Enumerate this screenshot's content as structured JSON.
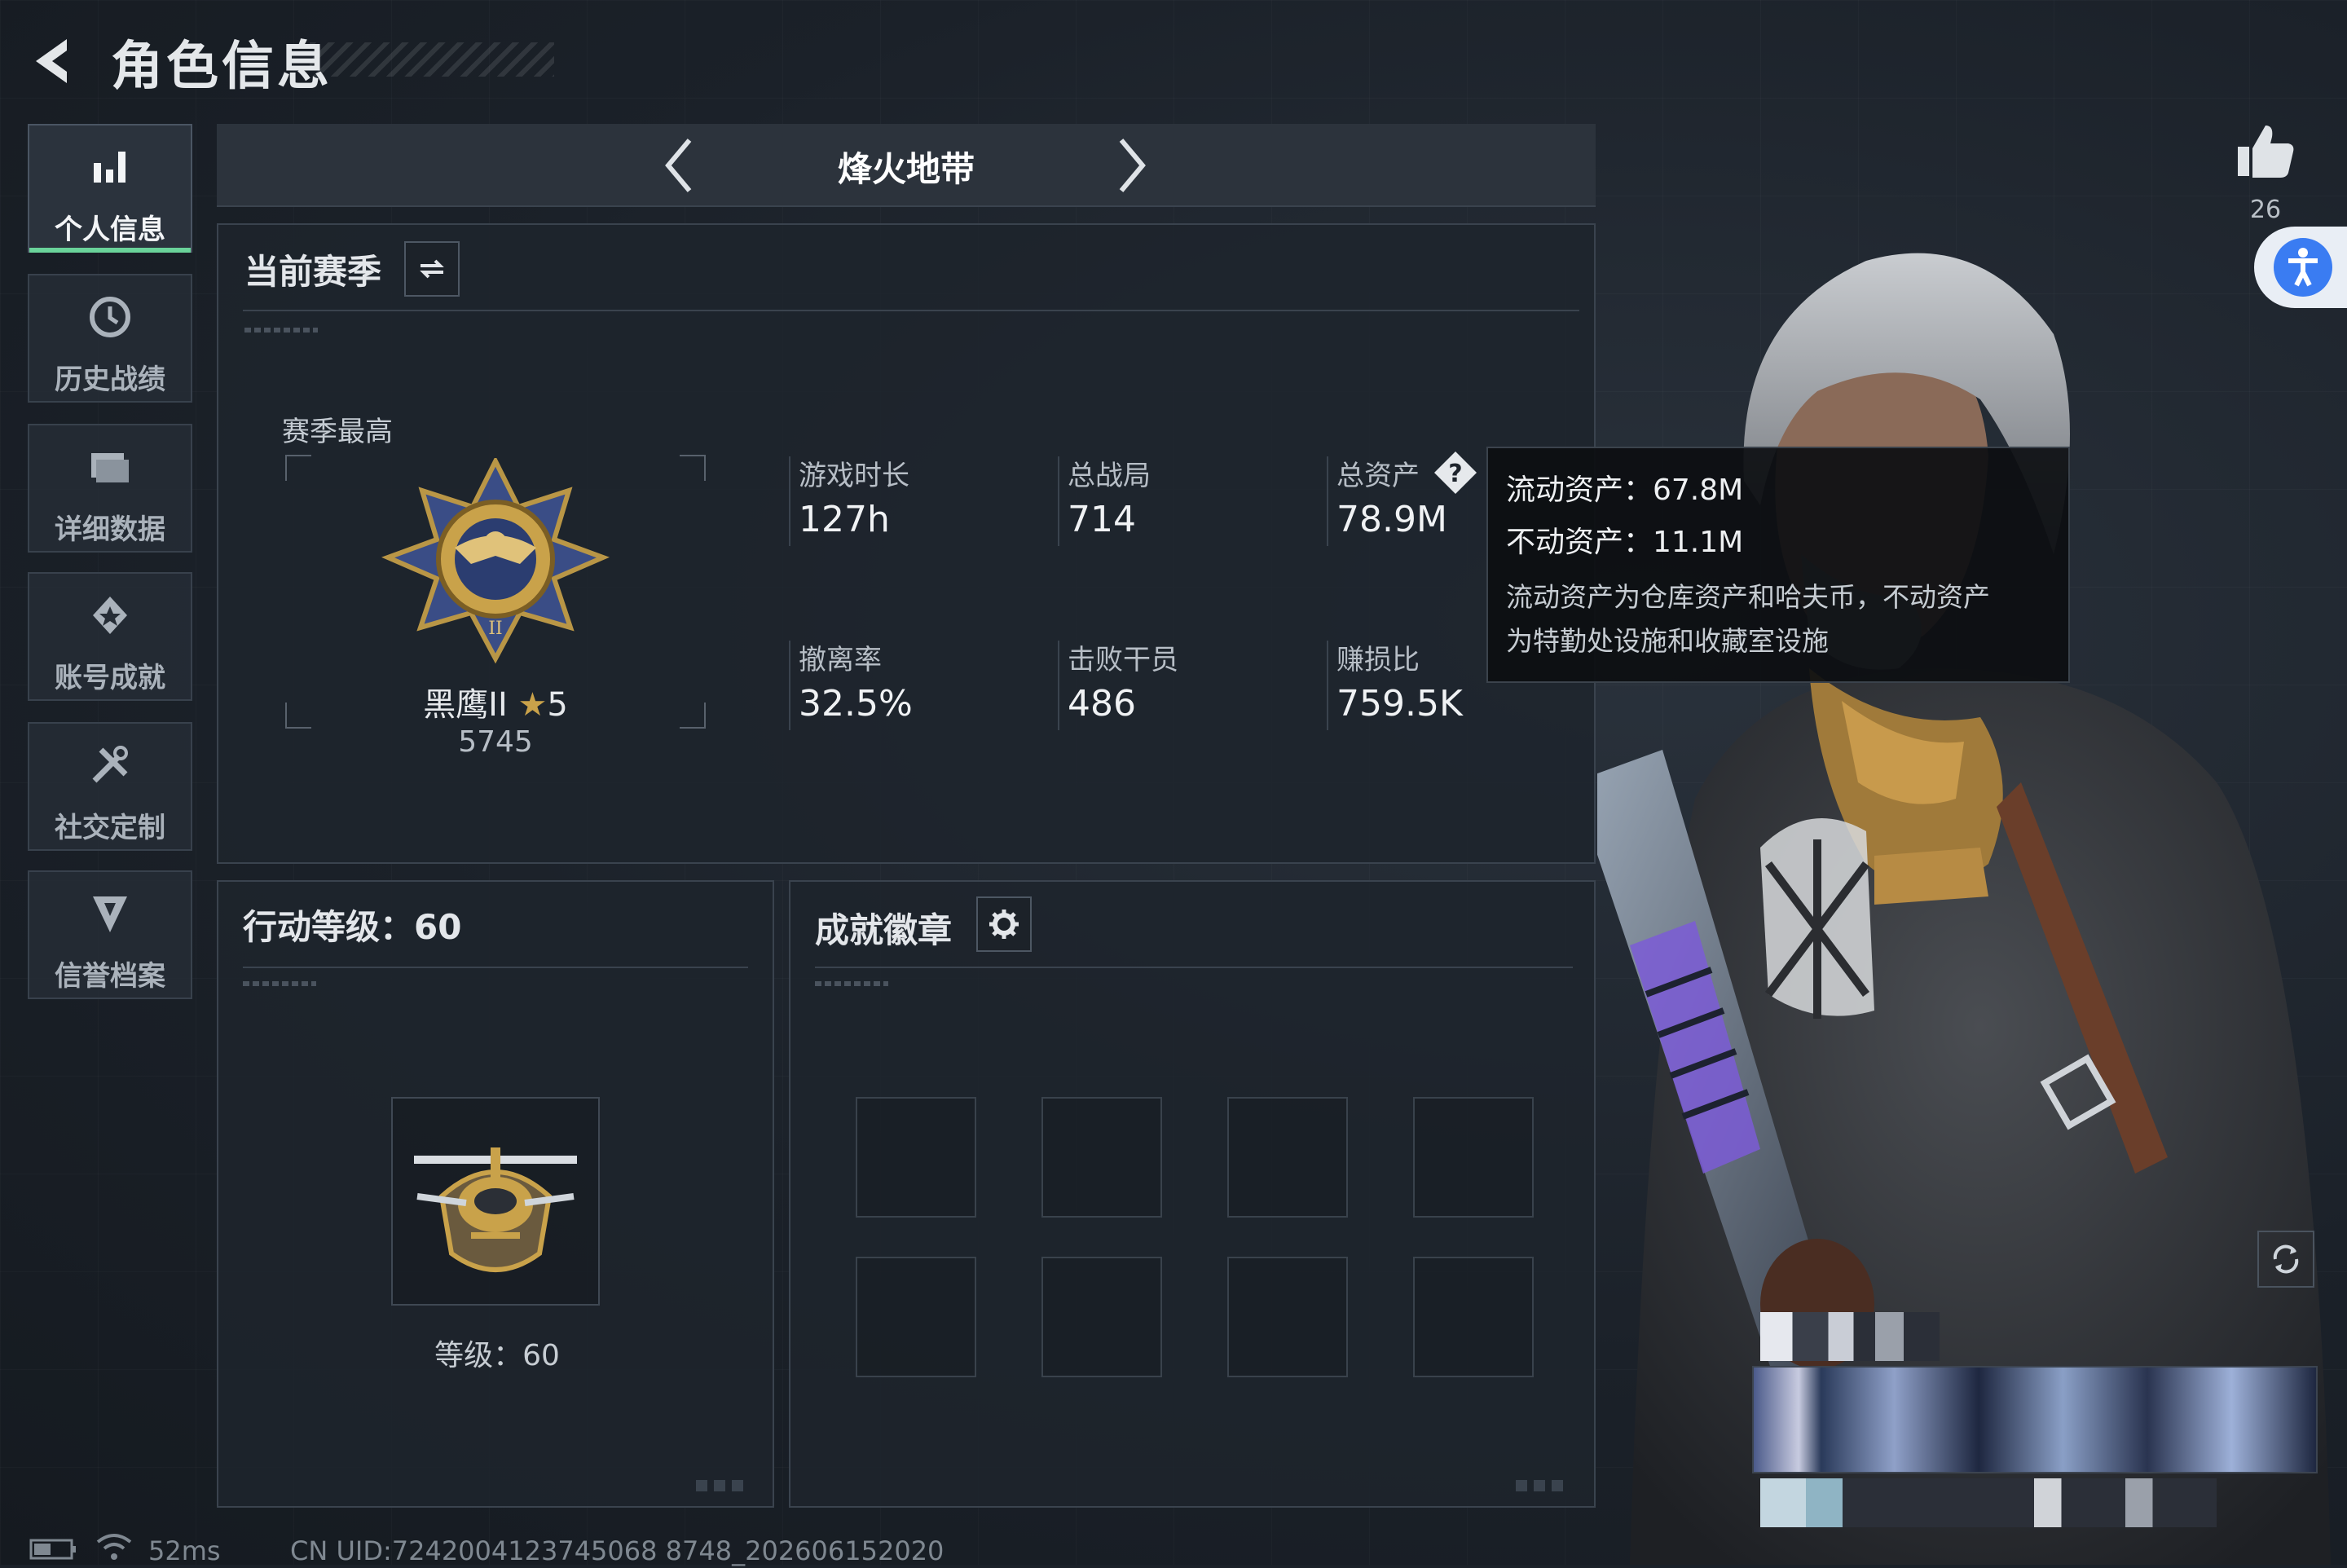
{
  "header": {
    "title": "角色信息"
  },
  "sidebar": {
    "items": [
      {
        "label": "个人信息",
        "icon": "bar-chart-icon",
        "active": true
      },
      {
        "label": "历史战绩",
        "icon": "history-icon"
      },
      {
        "label": "详细数据",
        "icon": "folder-icon"
      },
      {
        "label": "账号成就",
        "icon": "achievement-icon"
      },
      {
        "label": "社交定制",
        "icon": "tools-icon"
      },
      {
        "label": "信誉档案",
        "icon": "shield-icon"
      }
    ]
  },
  "mode": {
    "title": "烽火地带"
  },
  "season": {
    "title": "当前赛季",
    "best_label": "赛季最高",
    "rank_name": "黑鹰II",
    "rank_stars": "5",
    "rank_points": "5745",
    "stats": [
      {
        "label": "游戏时长",
        "value": "127h"
      },
      {
        "label": "总战局",
        "value": "714"
      },
      {
        "label": "总资产",
        "value": "78.9M"
      },
      {
        "label": "撤离率",
        "value": "32.5%"
      },
      {
        "label": "击败干员",
        "value": "486"
      },
      {
        "label": "赚损比",
        "value": "759.5K"
      }
    ]
  },
  "tooltip": {
    "liquid": "流动资产：67.8M",
    "fixed": "不动资产：11.1M",
    "desc_line1": "流动资产为仓库资产和哈夫币，不动资产",
    "desc_line2": "为特勤处设施和收藏室设施"
  },
  "action_level": {
    "title": "行动等级：60",
    "level_text": "等级：60"
  },
  "badges": {
    "title": "成就徽章"
  },
  "likes": {
    "count": "26"
  },
  "footer": {
    "ping": "52ms",
    "uid": "CN UID:7242004123745068 8748_202606152020"
  },
  "colors": {
    "accent_green": "#6ad39a",
    "accessibility_blue": "#3a7cf2",
    "gold": "#c9a24a",
    "purple": "#7b5cd6"
  }
}
